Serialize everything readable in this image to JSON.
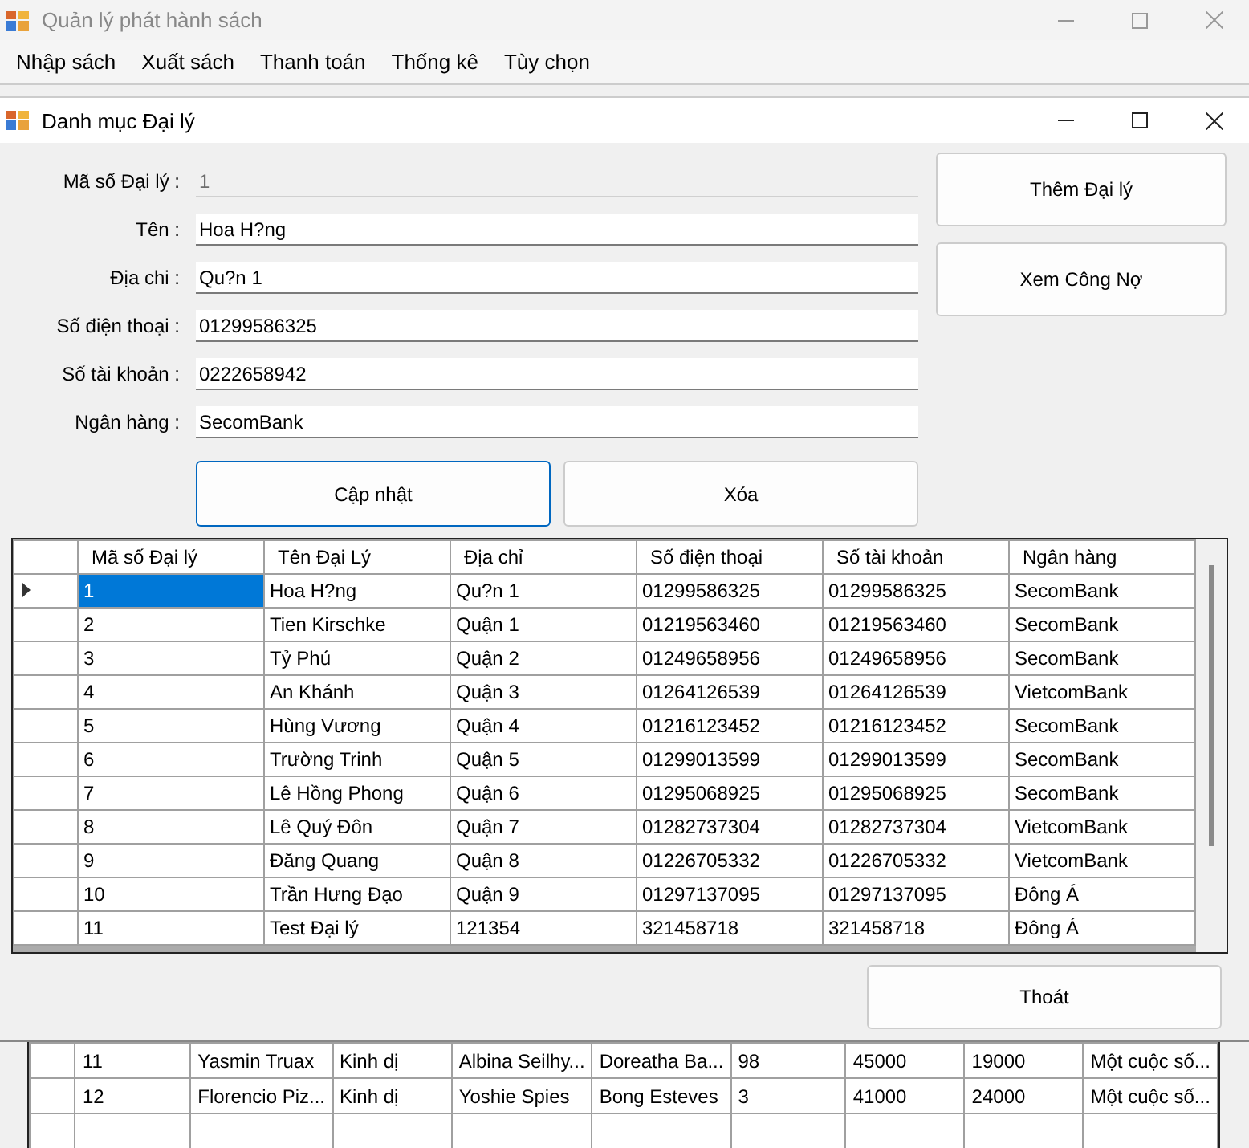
{
  "app_window": {
    "title": "Quản lý phát hành sách"
  },
  "menu": [
    "Nhập sách",
    "Xuất sách",
    "Thanh toán",
    "Thống kê",
    "Tùy chọn"
  ],
  "dialog": {
    "title": "Danh mục Đại lý",
    "fields": [
      {
        "label": "Mã số Đại lý :",
        "value": "1",
        "disabled": true
      },
      {
        "label": "Tên :",
        "value": "Hoa H?ng",
        "disabled": false
      },
      {
        "label": "Địa chi :",
        "value": "Qu?n 1",
        "disabled": false
      },
      {
        "label": "Số điện thoại :",
        "value": "01299586325",
        "disabled": false
      },
      {
        "label": "Số tài khoản :",
        "value": "0222658942",
        "disabled": false
      },
      {
        "label": "Ngân hàng :",
        "value": "SecomBank",
        "disabled": false
      }
    ],
    "side_buttons": [
      "Thêm Đại lý",
      "Xem Công Nợ"
    ],
    "action_buttons": [
      {
        "label": "Cập nhật",
        "focused": true
      },
      {
        "label": "Xóa",
        "focused": false
      }
    ],
    "table": {
      "columns": [
        "Mã số Đại lý",
        "Tên Đại Lý",
        "Địa chỉ",
        "Số điện thoại",
        "Số tài khoản",
        "Ngân hàng"
      ],
      "rows": [
        {
          "cells": [
            "1",
            "Hoa H?ng",
            "Qu?n 1",
            "01299586325",
            "01299586325",
            "SecomBank"
          ],
          "selected": true
        },
        {
          "cells": [
            "2",
            "Tien Kirschke",
            "Quận 1",
            "01219563460",
            "01219563460",
            "SecomBank"
          ],
          "selected": false
        },
        {
          "cells": [
            "3",
            "Tỷ Phú",
            "Quận 2",
            "01249658956",
            "01249658956",
            "SecomBank"
          ],
          "selected": false
        },
        {
          "cells": [
            "4",
            "An Khánh",
            "Quận 3",
            "01264126539",
            "01264126539",
            "VietcomBank"
          ],
          "selected": false
        },
        {
          "cells": [
            "5",
            "Hùng Vương",
            "Quận 4",
            "01216123452",
            "01216123452",
            "SecomBank"
          ],
          "selected": false
        },
        {
          "cells": [
            "6",
            "Trường Trinh",
            "Quận 5",
            "01299013599",
            "01299013599",
            "SecomBank"
          ],
          "selected": false
        },
        {
          "cells": [
            "7",
            "Lê Hồng Phong",
            "Quận 6",
            "01295068925",
            "01295068925",
            "SecomBank"
          ],
          "selected": false
        },
        {
          "cells": [
            "8",
            "Lê Quý Đôn",
            "Quận 7",
            "01282737304",
            "01282737304",
            "VietcomBank"
          ],
          "selected": false
        },
        {
          "cells": [
            "9",
            "Đăng Quang",
            "Quận 8",
            "01226705332",
            "01226705332",
            "VietcomBank"
          ],
          "selected": false
        },
        {
          "cells": [
            "10",
            "Trần Hưng Đạo",
            "Quận 9",
            "01297137095",
            "01297137095",
            "Đông Á"
          ],
          "selected": false
        },
        {
          "cells": [
            "11",
            "Test Đại lý",
            "121354",
            "321458718",
            "321458718",
            "Đông Á"
          ],
          "selected": false
        }
      ]
    },
    "exit_button": "Thoát"
  },
  "background_table": {
    "rows": [
      {
        "cells": [
          "11",
          "Yasmin Truax",
          "Kinh dị",
          "Albina Seilhy...",
          "Doreatha Ba...",
          "98",
          "45000",
          "19000",
          "Một cuộc số..."
        ]
      },
      {
        "cells": [
          "12",
          "Florencio Piz...",
          "Kinh dị",
          "Yoshie Spies",
          "Bong Esteves",
          "3",
          "41000",
          "24000",
          "Một cuộc số..."
        ]
      }
    ]
  }
}
